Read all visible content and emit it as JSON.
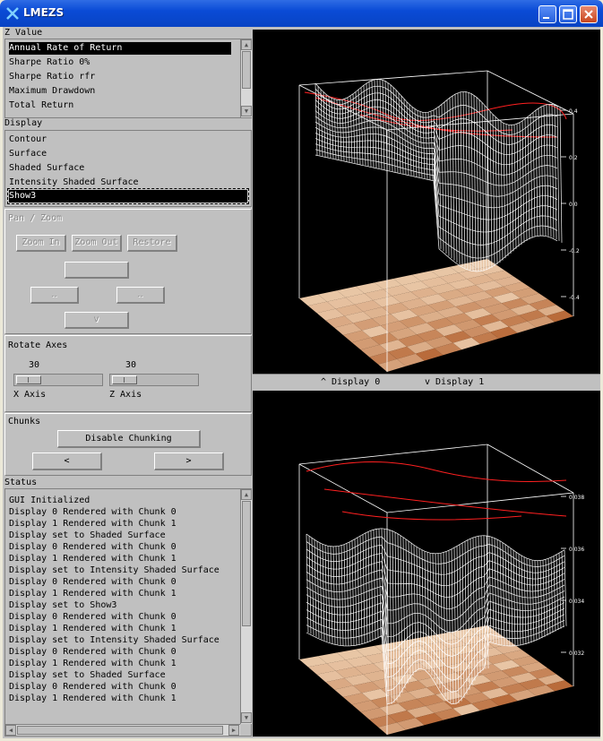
{
  "window": {
    "title": "LMEZS"
  },
  "zvalue": {
    "label": "Z Value",
    "items": [
      "Annual Rate of Return",
      "Sharpe Ratio 0%",
      "Sharpe Ratio rfr",
      "Maximum Drawdown",
      "Total Return"
    ],
    "selected": "Annual Rate of Return"
  },
  "display": {
    "label": "Display",
    "items": [
      "Contour",
      "Surface",
      "Shaded Surface",
      "Intensity Shaded Surface",
      "Show3"
    ],
    "selected": "Show3"
  },
  "panzoom": {
    "label": "Pan / Zoom",
    "zoom_in": "Zoom In",
    "zoom_out": "Zoom Out",
    "restore": "Restore",
    "left_glyph": "‥",
    "right_glyph": "‥",
    "down_glyph": "v"
  },
  "rotate": {
    "label": "Rotate Axes",
    "x_value": "30",
    "x_label": "X Axis",
    "z_value": "30",
    "z_label": "Z Axis"
  },
  "chunks": {
    "label": "Chunks",
    "disable_button": "Disable Chunking",
    "prev_button": "<",
    "next_button": ">"
  },
  "status": {
    "label": "Status",
    "lines": [
      "GUI Initialized",
      "Display 0 Rendered with Chunk 0",
      "Display 1 Rendered with Chunk 1",
      "Display set to Shaded Surface",
      "Display 0 Rendered with Chunk 0",
      "Display 1 Rendered with Chunk 1",
      "Display set to Intensity Shaded Surface",
      "Display 0 Rendered with Chunk 0",
      "Display 1 Rendered with Chunk 1",
      "Display set to Show3",
      "Display 0 Rendered with Chunk 0",
      "Display 1 Rendered with Chunk 1",
      "Display set to Intensity Shaded Surface",
      "Display 0 Rendered with Chunk 0",
      "Display 1 Rendered with Chunk 1",
      "Display set to Shaded Surface",
      "Display 0 Rendered with Chunk 0",
      "Display 1 Rendered with Chunk 1"
    ]
  },
  "displays": {
    "up_label": "^ Display 0",
    "down_label": "v Display 1",
    "d0_ticks": [
      "0.4",
      "0.2",
      "0.0",
      "-0.2",
      "-0.4"
    ],
    "d1_ticks": [
      "0.038",
      "0.036",
      "0.034",
      "0.032"
    ]
  },
  "colors": {
    "titlebar": "#0a4bd6",
    "surface_mesh": "#ffffff",
    "contour": "#ff2020",
    "heatmap_dark": "#8a2a00",
    "heatmap_light": "#fff2d8"
  }
}
